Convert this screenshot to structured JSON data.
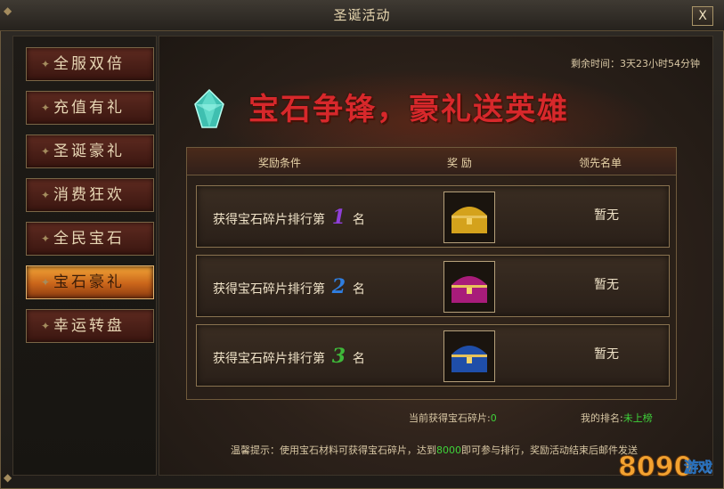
{
  "window": {
    "title": "圣诞活动",
    "close_label": "X"
  },
  "sidebar": {
    "items": [
      {
        "label": "全服双倍",
        "active": false
      },
      {
        "label": "充值有礼",
        "active": false
      },
      {
        "label": "圣诞豪礼",
        "active": false
      },
      {
        "label": "消费狂欢",
        "active": false
      },
      {
        "label": "全民宝石",
        "active": false
      },
      {
        "label": "宝石豪礼",
        "active": true
      },
      {
        "label": "幸运转盘",
        "active": false
      }
    ]
  },
  "main": {
    "time_remaining": "剩余时间：3天23小时54分钟",
    "banner_title": "宝石争锋，豪礼送英雄",
    "table": {
      "headers": {
        "condition": "奖励条件",
        "reward": "奖 励",
        "leader": "领先名单"
      },
      "rows": [
        {
          "prefix": "获得宝石碎片排行第",
          "rank": "1",
          "suffix": "名",
          "leader": "暂无",
          "rank_color": "#8f3fd8",
          "chest_color": "#d4a21c"
        },
        {
          "prefix": "获得宝石碎片排行第",
          "rank": "2",
          "suffix": "名",
          "leader": "暂无",
          "rank_color": "#2f7ee0",
          "chest_color": "#a81c7a"
        },
        {
          "prefix": "获得宝石碎片排行第",
          "rank": "3",
          "suffix": "名",
          "leader": "暂无",
          "rank_color": "#3fb83a",
          "chest_color": "#1f4ea8"
        }
      ]
    },
    "current_label": "当前获得宝石碎片:",
    "current_value": "0",
    "my_rank_label": "我的排名:",
    "my_rank_value": "未上榜",
    "tip_prefix": "温馨提示：使用宝石材料可获得宝石碎片，达到",
    "tip_threshold": "8000",
    "tip_suffix": "即可参与排行，奖励活动结束后邮件发送"
  },
  "watermark": {
    "text": "8090游戏"
  }
}
